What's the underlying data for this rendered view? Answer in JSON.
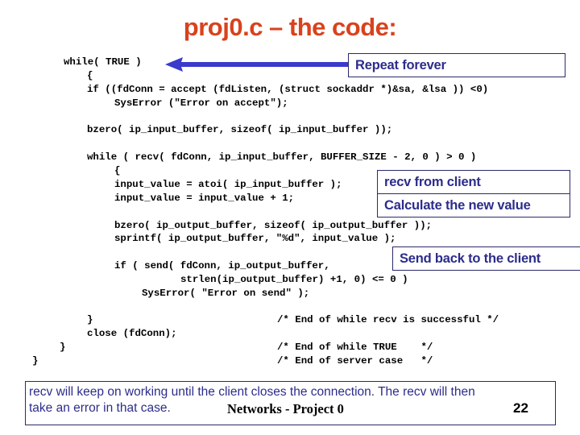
{
  "slide": {
    "title": "proj0.c – the code:",
    "code_lines": {
      "l01": "while( TRUE )",
      "l02": "{",
      "l03": "if ((fdConn = accept (fdListen, (struct sockaddr *)&sa, &lsa )) <0)",
      "l04": "SysError (\"Error on accept\");",
      "l05": "bzero( ip_input_buffer, sizeof( ip_input_buffer ));",
      "l06": "while ( recv( fdConn, ip_input_buffer, BUFFER_SIZE - 2, 0 ) > 0 )",
      "l07": "{",
      "l08": "input_value = atoi( ip_input_buffer );",
      "l09": "input_value = input_value + 1;",
      "l10": "bzero( ip_output_buffer, sizeof( ip_output_buffer ));",
      "l11": "sprintf( ip_output_buffer, \"%d\", input_value );",
      "l12": "if ( send( fdConn, ip_output_buffer,",
      "l13": "strlen(ip_output_buffer) +1, 0) <= 0 )",
      "l14": "SysError( \"Error on send\" );",
      "l15": "}",
      "l16": "close (fdConn);",
      "l17": "}",
      "l18": "}"
    },
    "comments": {
      "c1": "/* End of while recv is successful */",
      "c2": "/* End of while TRUE    */",
      "c3": "/* End of server case   */"
    },
    "callouts": {
      "repeat": "Repeat forever",
      "recv": "recv from client",
      "calc": "Calculate the new value",
      "send": "Send back to the client"
    },
    "footer": {
      "note_line1": "recv will keep on working until the client closes the connection.  The recv will then",
      "note_line2": "take an error in that case.",
      "course": "Networks - Project 0",
      "page_number": "22"
    },
    "colors": {
      "title": "#d9421c",
      "callout_text": "#2c2c8c",
      "arrow": "#3a3acc",
      "border": "#2a2a6a"
    }
  }
}
